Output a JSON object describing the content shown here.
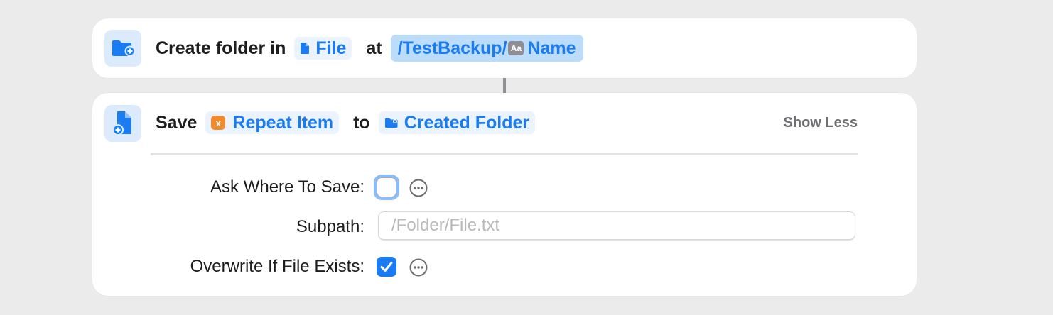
{
  "create_action": {
    "icon": "folder-plus-icon",
    "verb": "Create folder in",
    "file_token": "File",
    "at_word": "at",
    "path_prefix": "/TestBackup/",
    "path_var_badge": "Aa",
    "path_var_name": "Name"
  },
  "save_action": {
    "icon": "document-save-icon",
    "verb": "Save",
    "item_badge": "x",
    "item_token": "Repeat Item",
    "to_word": "to",
    "folder_token": "Created Folder",
    "toggle_label": "Show Less",
    "params": {
      "ask_where_label": "Ask Where To Save:",
      "ask_where_checked": false,
      "subpath_label": "Subpath:",
      "subpath_value": "",
      "subpath_placeholder": "/Folder/File.txt",
      "overwrite_label": "Overwrite If File Exists:",
      "overwrite_checked": true
    }
  },
  "colors": {
    "accent": "#1a7cf0",
    "token_bg": "#eaf3fe",
    "path_token_bg": "#bcdcfb",
    "icon_tile_bg": "#dcebfb",
    "variable_orange": "#f28a2e",
    "background": "#ebebeb"
  }
}
